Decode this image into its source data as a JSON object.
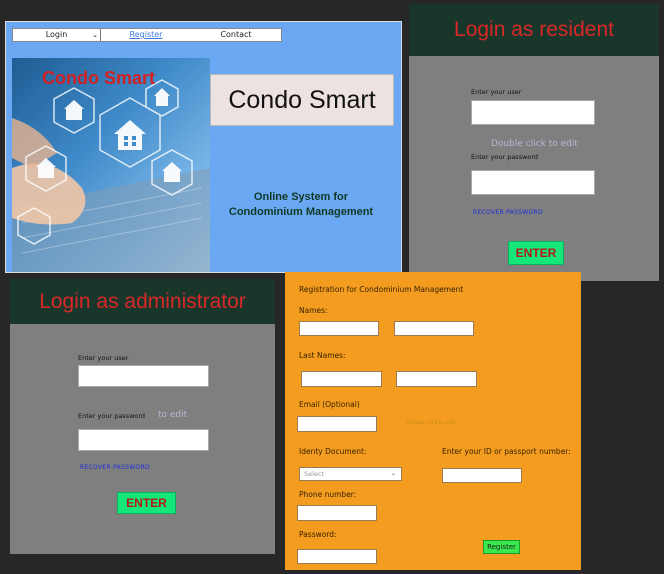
{
  "home": {
    "nav": {
      "login_label": "Login",
      "register_label": "Register",
      "contact_label": "Contact"
    },
    "hero_title": "Condo Smart",
    "brand_title": "Condo Smart",
    "tagline_line1": "Online System for",
    "tagline_line2": "Condominium Management"
  },
  "resident": {
    "heading": "Login as resident",
    "user_label": "Enter your user",
    "hint": "Double click to edit",
    "password_label": "Enter your password",
    "recover": "RECOVER PASSWORD",
    "enter": "ENTER"
  },
  "admin": {
    "heading": "Login as administrator",
    "user_label": "Enter your user",
    "password_label": "Enter your password",
    "hint": "to edit",
    "recover": "RECOVER PASSWORD",
    "enter": "ENTER"
  },
  "registration": {
    "title": "Registration for Condominium Management",
    "names_label": "Names:",
    "last_names_label": "Last Names:",
    "email_label": "Email (Optional)",
    "faint_text": "Double click to edit",
    "id_doc_label": "Identy Document:",
    "id_doc_selected": "Select",
    "id_number_label": "Enter your ID or passport number:",
    "phone_label": "Phone number:",
    "password_label": "Password:",
    "register_button": "Register"
  },
  "colors": {
    "login_header_bg": "#19362a",
    "login_header_text": "#d82828",
    "enter_button": "#14e679",
    "registration_bg": "#f39c1f",
    "home_bg": "#6aa8f3"
  }
}
